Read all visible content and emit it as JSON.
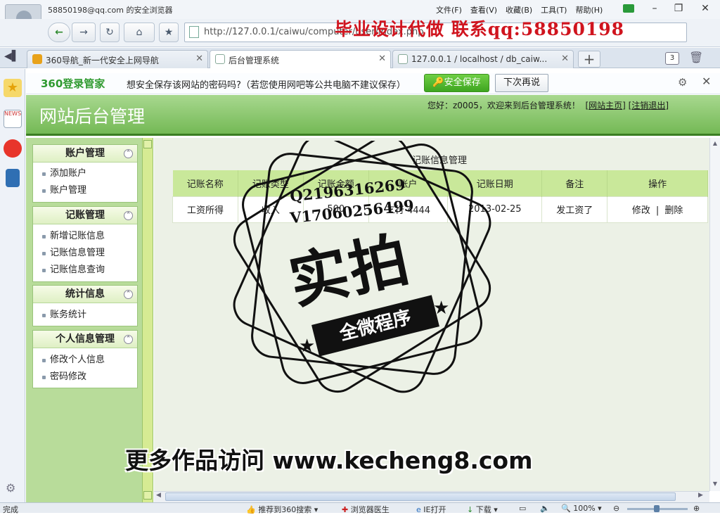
{
  "browser": {
    "account": "58850198@qq.com 的安全浏览器",
    "menu": [
      "文件(F)",
      "查看(V)",
      "收藏(B)",
      "工具(T)",
      "帮助(H)"
    ],
    "url": "http://127.0.0.1/caiwu/computer/user/index.php",
    "overlay_banner": "毕业设计代做 联系qq:58850198",
    "tabs": [
      {
        "title": "360导航_新一代安全上网导航",
        "active": false
      },
      {
        "title": "后台管理系统",
        "active": true
      },
      {
        "title": "127.0.0.1 / localhost / db_caiw...",
        "active": false
      }
    ],
    "tab_count": "3"
  },
  "password_bar": {
    "logo": "360登录管家",
    "message": "想安全保存该网站的密码吗?（若您使用网吧等公共电脑不建议保存）",
    "save_label": "安全保存",
    "later_label": "下次再说"
  },
  "admin": {
    "title": "网站后台管理",
    "welcome": "您好：z0005，欢迎来到后台管理系统！",
    "home_link": "网站主页",
    "logout_link": "注销退出"
  },
  "menu_groups": [
    {
      "title": "账户管理",
      "items": [
        "添加账户",
        "账户管理"
      ]
    },
    {
      "title": "记账管理",
      "items": [
        "新增记账信息",
        "记账信息管理",
        "记账信息查询"
      ]
    },
    {
      "title": "统计信息",
      "items": [
        "账务统计"
      ]
    },
    {
      "title": "个人信息管理",
      "items": [
        "修改个人信息",
        "密码修改"
      ]
    }
  ],
  "content": {
    "heading": "记账信息管理",
    "columns": [
      "记账名称",
      "记账类型",
      "记账金额",
      "账户",
      "记账日期",
      "备注",
      "操作"
    ],
    "rows": [
      {
        "name": "工资所得",
        "type": "收入",
        "amount": "500",
        "account": "工行 4444",
        "date": "2013-02-25",
        "note": "发工资了",
        "edit": "修改",
        "sep": "|",
        "delete": "删除"
      }
    ]
  },
  "watermark": {
    "qq": "Q2196316269",
    "wx": "V17060256499",
    "big": "实拍",
    "ribbon": "全微程序",
    "bottom": "更多作品访问 www.kecheng8.com"
  },
  "status": {
    "left": "完成",
    "recommend": "推荐到360搜索",
    "doctor": "浏览器医生",
    "ie": "IE打开",
    "download": "下载",
    "zoom": "100%"
  },
  "colors": {
    "header_green": "#74b955",
    "table_head": "#c9e89a",
    "save_green": "#3ea520",
    "banner_red": "#d0141e"
  }
}
